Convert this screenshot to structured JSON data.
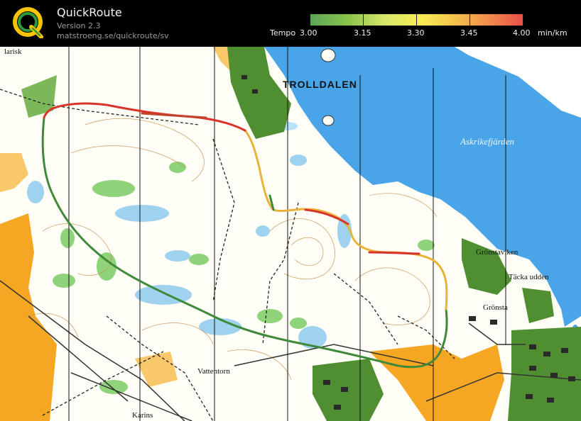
{
  "header": {
    "app_name": "QuickRoute",
    "version": "Version 2.3",
    "url": "matstroeng.se/quickroute/sv"
  },
  "legend": {
    "prefix": "Tempo",
    "ticks": [
      "3.00",
      "3.15",
      "3.30",
      "3.45",
      "4.00"
    ],
    "unit": "min/km",
    "gradient_colors": [
      "#5aa65a",
      "#8bc34a",
      "#d6e86b",
      "#f7ec54",
      "#f6c24a",
      "#f28a4d",
      "#e85048"
    ]
  },
  "map": {
    "places": {
      "trolldalen": "TROLLDALEN",
      "askrikefjarden": "Askrikefjärden",
      "gronstaviken": "Grönstaviken",
      "tacka_udden": "Täcka udden",
      "gronsta": "Grönsta",
      "vattentorn": "Vattentorn",
      "karins": "Karins",
      "flarisk": "larisk"
    },
    "colors": {
      "water": "#4aa4e8",
      "forest_green": "#5fa33d",
      "open_land": "#f5a623",
      "route_slow": "#d9342b",
      "route_fast": "#3f8a3a"
    }
  }
}
